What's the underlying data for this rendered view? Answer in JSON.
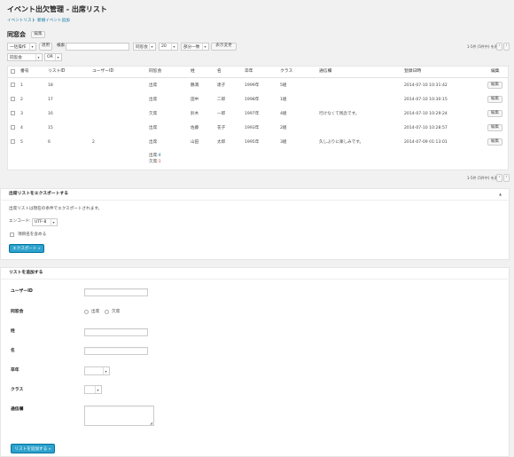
{
  "page": {
    "title": "イベント出欠管理 - 出席リスト",
    "subnav": {
      "event_list": "イベントリスト",
      "separator": "|",
      "new_event": "新規イベント追加"
    },
    "event_name": "同窓会",
    "edit_label": "編集"
  },
  "toolbar": {
    "bulk_action": "一括操作",
    "apply_label": "適用",
    "search_label": "検索",
    "search_value": "",
    "field_select": "同窓会",
    "per_page": "20",
    "match_select": "部分一致",
    "display_change": "表示変更",
    "count_text": "1-5件 (5件中) を表示",
    "filter_select": "同窓会",
    "andor_select": "OR"
  },
  "table": {
    "columns": [
      "番号",
      "リストID",
      "ユーザーID",
      "同窓会",
      "姓",
      "名",
      "卒年",
      "クラス",
      "通信欄",
      "登録日時",
      "編集"
    ],
    "rows": [
      {
        "no": "1",
        "list_id": "18",
        "user_id": "",
        "status": "出席",
        "sei": "鶴満",
        "mei": "達子",
        "year": "1999年",
        "class": "5組",
        "note": "",
        "date": "2014-07-10 10:31:42",
        "edit": "編集"
      },
      {
        "no": "2",
        "list_id": "17",
        "user_id": "",
        "status": "出席",
        "sei": "田中",
        "mei": "二郎",
        "year": "1998年",
        "class": "1組",
        "note": "",
        "date": "2014-07-10 10:30:15",
        "edit": "編集"
      },
      {
        "no": "3",
        "list_id": "16",
        "user_id": "",
        "status": "欠席",
        "sei": "鈴木",
        "mei": "一郎",
        "year": "1997年",
        "class": "4組",
        "note": "行けなくて残念です。",
        "date": "2014-07-10 10:29:24",
        "edit": "編集"
      },
      {
        "no": "4",
        "list_id": "15",
        "user_id": "",
        "status": "出席",
        "sei": "佐藤",
        "mei": "花子",
        "year": "1993年",
        "class": "2組",
        "note": "",
        "date": "2014-07-10 10:28:57",
        "edit": "編集"
      },
      {
        "no": "5",
        "list_id": "6",
        "user_id": "2",
        "status": "出席",
        "sei": "山田",
        "mei": "太郎",
        "year": "1995年",
        "class": "3組",
        "note": "久しぶりに楽しみです。",
        "date": "2014-07-09 01:13:01",
        "edit": "編集"
      }
    ],
    "summary_present_label": "出席:",
    "summary_present_count": "4",
    "summary_absent_label": "欠席:",
    "summary_absent_count": "1",
    "count_text_bottom": "1-5件 (5件中) を表示"
  },
  "export": {
    "title": "出席リストをエクスポートする",
    "toggle": "▲",
    "description": "出席リストは現在の条件でエクスポートされます。",
    "encode_label": "エンコード:",
    "encode_value": "UTF-8",
    "include_name_label": "項目名を含める",
    "export_button": "エクスポート »"
  },
  "add": {
    "title": "リストを追加する",
    "user_id_label": "ユーザーID",
    "attend_label": "同窓会",
    "option_present": "出席",
    "option_absent": "欠席",
    "sei_label": "姓",
    "mei_label": "名",
    "year_label": "卒年",
    "class_label": "クラス",
    "note_label": "通信欄",
    "submit_label": "リストを追加する »"
  },
  "colors": {
    "accent": "#2ea2cc",
    "link": "#0074a2",
    "present": "#0074a2",
    "absent": "#d54e21"
  }
}
